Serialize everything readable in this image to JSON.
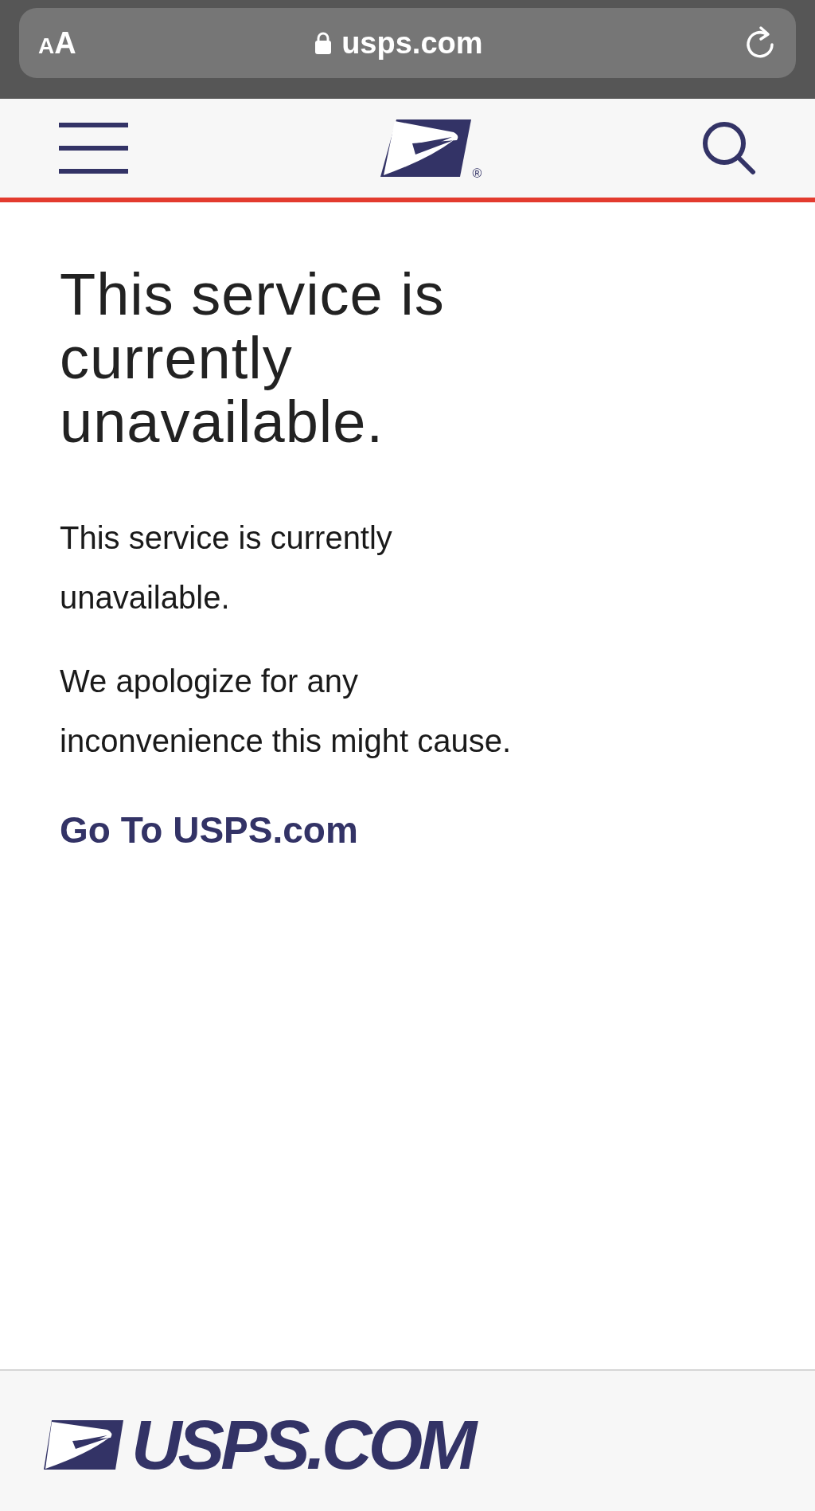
{
  "browser_bar": {
    "text_size_button": "AA",
    "url": "usps.com"
  },
  "header": {
    "registered_mark": "®"
  },
  "message": {
    "title": "This service is currently unavailable.",
    "paragraphs": [
      "This service is currently unavailable.",
      "We apologize for any inconvenience this might cause."
    ],
    "link": "Go To USPS.com"
  },
  "footer": {
    "brand": "USPS.COM"
  }
}
